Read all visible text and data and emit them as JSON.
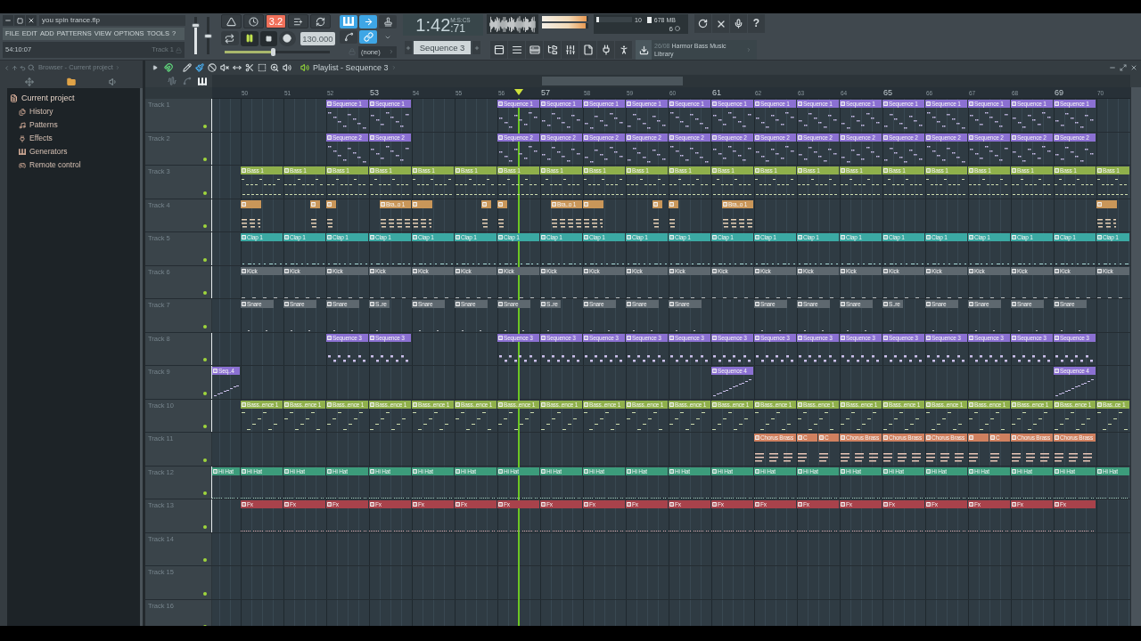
{
  "window": {
    "title": "you spin trance.flp"
  },
  "menu": [
    "FILE",
    "EDIT",
    "ADD",
    "PATTERNS",
    "VIEW",
    "OPTIONS",
    "TOOLS",
    "?"
  ],
  "hint_bar": {
    "position": "54:10:07",
    "target": "Track 1"
  },
  "mixer_sliders": [
    {
      "kind": "volume",
      "level": 0.8
    },
    {
      "kind": "pitch",
      "level": 0.5
    }
  ],
  "transport": {
    "buttons": [
      {
        "kind": "metronome",
        "on": false
      },
      {
        "kind": "wait",
        "on": false
      },
      {
        "kind": "countdown",
        "label": "3.2",
        "on": true
      },
      {
        "kind": "overdub",
        "on": false
      },
      {
        "kind": "loop",
        "on": false
      }
    ],
    "playing": true,
    "recording": false,
    "tempo": "130.000",
    "position": {
      "level": 0.46
    }
  },
  "snap_tools": {
    "buttons": [
      {
        "kind": "keyboard",
        "on": true
      },
      {
        "kind": "step",
        "on": true
      },
      {
        "kind": "stamp",
        "on": false
      },
      {
        "kind": "curve",
        "on": false
      },
      {
        "kind": "link",
        "on": true
      }
    ],
    "snap": "(none)"
  },
  "clock": {
    "time": "1:42",
    "fraction": ":71",
    "unit": "M:S:CS"
  },
  "pattern_selector": {
    "value": "Sequence 3"
  },
  "meters": {
    "output": [
      {
        "level": 0.97
      },
      {
        "level": 0.95
      }
    ],
    "cpu": {
      "value": "10",
      "level": 0.08
    },
    "memory": {
      "value": "678 MB"
    },
    "polyphony": "6"
  },
  "help_button": {
    "label": "?"
  },
  "news": {
    "date": "26/08",
    "title": "Harmor Bass Music Library"
  },
  "browser": {
    "title": "Browser - Current project",
    "tabs": [
      {
        "kind": "move",
        "selected": false
      },
      {
        "kind": "folder",
        "selected": true
      },
      {
        "kind": "speaker",
        "selected": false
      }
    ],
    "tree": [
      {
        "label": "Current project",
        "children": [
          {
            "label": "History"
          },
          {
            "label": "Patterns"
          },
          {
            "label": "Effects"
          },
          {
            "label": "Generators"
          },
          {
            "label": "Remote control"
          }
        ]
      }
    ]
  },
  "playlist": {
    "title": "Playlist - Sequence 3",
    "magnet": {
      "on": true
    },
    "tools": [
      {
        "kind": "pencil",
        "selected": false
      },
      {
        "kind": "brush",
        "selected": true
      },
      {
        "kind": "delete",
        "selected": false
      },
      {
        "kind": "mute",
        "selected": false
      },
      {
        "kind": "slip",
        "selected": false
      },
      {
        "kind": "slice",
        "selected": false
      },
      {
        "kind": "select",
        "selected": false
      },
      {
        "kind": "zoom",
        "selected": false
      },
      {
        "kind": "playback",
        "selected": false
      }
    ],
    "clip_filters": [
      {
        "kind": "audio",
        "selected": false
      },
      {
        "kind": "automation",
        "selected": false
      },
      {
        "kind": "pattern",
        "selected": true
      }
    ],
    "ruler": [
      {
        "label": "50",
        "major": false
      },
      {
        "label": "51",
        "major": false
      },
      {
        "label": "52",
        "major": false
      },
      {
        "label": "53",
        "major": true
      },
      {
        "label": "54",
        "major": false
      },
      {
        "label": "55",
        "major": false
      },
      {
        "label": "56",
        "major": false
      },
      {
        "label": "57",
        "major": true
      },
      {
        "label": "58",
        "major": false
      },
      {
        "label": "59",
        "major": false
      },
      {
        "label": "60",
        "major": false
      },
      {
        "label": "61",
        "major": true
      },
      {
        "label": "62",
        "major": false
      },
      {
        "label": "63",
        "major": false
      },
      {
        "label": "64",
        "major": false
      },
      {
        "label": "65",
        "major": true
      },
      {
        "label": "66",
        "major": false
      },
      {
        "label": "67",
        "major": false
      },
      {
        "label": "68",
        "major": false
      },
      {
        "label": "69",
        "major": true
      },
      {
        "label": "70",
        "major": false
      }
    ],
    "playhead": {
      "level": 0.334
    },
    "tracks": [
      {
        "name": "Track 1",
        "active": true,
        "enabled": true,
        "color": "#8b70d2",
        "bars": [
          {
            "kind": "empty"
          },
          {
            "kind": "empty"
          },
          {
            "label": "Sequence 1",
            "kind": "whole"
          },
          {
            "label": "Sequence 1",
            "kind": "whole"
          },
          {
            "kind": "empty"
          },
          {
            "kind": "empty"
          },
          {
            "label": "Sequence 1",
            "kind": "whole"
          },
          {
            "label": "Sequence 1",
            "kind": "whole"
          },
          {
            "label": "Sequence 1",
            "kind": "whole"
          },
          {
            "label": "Sequence 1",
            "kind": "whole"
          },
          {
            "label": "Sequence 1",
            "kind": "whole"
          },
          {
            "label": "Sequence 1",
            "kind": "whole"
          },
          {
            "label": "Sequence 1",
            "kind": "whole"
          },
          {
            "label": "Sequence 1",
            "kind": "whole"
          },
          {
            "label": "Sequence 1",
            "kind": "whole"
          },
          {
            "label": "Sequence 1",
            "kind": "whole"
          },
          {
            "label": "Sequence 1",
            "kind": "whole"
          },
          {
            "label": "Sequence 1",
            "kind": "whole"
          },
          {
            "label": "Sequence 1",
            "kind": "whole"
          },
          {
            "label": "Sequence 1",
            "kind": "whole"
          }
        ]
      },
      {
        "name": "Track 2",
        "active": true,
        "enabled": true,
        "color": "#8b70d2",
        "bars": [
          {
            "kind": "empty"
          },
          {
            "kind": "empty"
          },
          {
            "label": "Sequence 2",
            "kind": "whole"
          },
          {
            "label": "Sequence 2",
            "kind": "whole"
          },
          {
            "kind": "empty"
          },
          {
            "kind": "empty"
          },
          {
            "label": "Sequence 2",
            "kind": "whole"
          },
          {
            "label": "Sequence 2",
            "kind": "whole"
          },
          {
            "label": "Sequence 2",
            "kind": "whole"
          },
          {
            "label": "Sequence 2",
            "kind": "whole"
          },
          {
            "label": "Sequence 2",
            "kind": "whole"
          },
          {
            "label": "Sequence 2",
            "kind": "whole"
          },
          {
            "label": "Sequence 2",
            "kind": "whole"
          },
          {
            "label": "Sequence 2",
            "kind": "whole"
          },
          {
            "label": "Sequence 2",
            "kind": "whole"
          },
          {
            "label": "Sequence 2",
            "kind": "whole"
          },
          {
            "label": "Sequence 2",
            "kind": "whole"
          },
          {
            "label": "Sequence 2",
            "kind": "whole"
          },
          {
            "label": "Sequence 2",
            "kind": "whole"
          },
          {
            "label": "Sequence 2",
            "kind": "whole"
          }
        ]
      },
      {
        "name": "Track 3",
        "active": true,
        "enabled": true,
        "color": "#8fb04b",
        "bars": [
          {
            "label": "Bass 1",
            "kind": "whole"
          },
          {
            "label": "Bass 1",
            "kind": "whole"
          },
          {
            "label": "Bass 1",
            "kind": "whole"
          },
          {
            "label": "Bass 1",
            "kind": "whole"
          },
          {
            "label": "Bass 1",
            "kind": "whole"
          },
          {
            "label": "Bass 1",
            "kind": "whole"
          },
          {
            "label": "Bass 1",
            "kind": "whole"
          },
          {
            "label": "Bass 1",
            "kind": "whole"
          },
          {
            "label": "Bass 1",
            "kind": "whole"
          },
          {
            "label": "Bass 1",
            "kind": "whole"
          },
          {
            "label": "Bass 1",
            "kind": "whole"
          },
          {
            "label": "Bass 1",
            "kind": "whole"
          },
          {
            "label": "Bass 1",
            "kind": "whole"
          },
          {
            "label": "Bass 1",
            "kind": "whole"
          },
          {
            "label": "Bass 1",
            "kind": "whole"
          },
          {
            "label": "Bass 1",
            "kind": "whole"
          },
          {
            "label": "Bass 1",
            "kind": "whole"
          },
          {
            "label": "Bass 1",
            "kind": "whole"
          },
          {
            "label": "Bass 1",
            "kind": "whole"
          },
          {
            "label": "Bass 1",
            "kind": "whole"
          },
          {
            "label": "Bass 1",
            "kind": "whole"
          }
        ]
      },
      {
        "name": "Track 4",
        "active": true,
        "enabled": true,
        "color": "#c99659",
        "bars": [
          {
            "kind": "half"
          },
          {
            "kind": "pickup"
          },
          {
            "kind": "quarter"
          },
          {
            "label": "Bra..o 1",
            "kind": "late"
          },
          {
            "kind": "half"
          },
          {
            "kind": "pickup"
          },
          {
            "kind": "quarter"
          },
          {
            "label": "Bra..o 1",
            "kind": "late"
          },
          {
            "kind": "half"
          },
          {
            "kind": "pickup"
          },
          {
            "kind": "quarter"
          },
          {
            "label": "Bra..o 1",
            "kind": "late"
          },
          {
            "kind": "empty"
          },
          {
            "kind": "empty"
          },
          {
            "kind": "empty"
          },
          {
            "kind": "empty"
          },
          {
            "kind": "empty"
          },
          {
            "kind": "empty"
          },
          {
            "kind": "empty"
          },
          {
            "kind": "empty"
          },
          {
            "kind": "half"
          }
        ]
      },
      {
        "name": "Track 5",
        "active": true,
        "enabled": true,
        "color": "#3ba9a3",
        "bars": [
          {
            "label": "Clap 1",
            "kind": "whole"
          },
          {
            "label": "Clap 1",
            "kind": "whole"
          },
          {
            "label": "Clap 1",
            "kind": "whole"
          },
          {
            "label": "Clap 1",
            "kind": "whole"
          },
          {
            "label": "Clap 1",
            "kind": "whole"
          },
          {
            "label": "Clap 1",
            "kind": "whole"
          },
          {
            "label": "Clap 1",
            "kind": "whole"
          },
          {
            "label": "Clap 1",
            "kind": "whole"
          },
          {
            "label": "Clap 1",
            "kind": "whole"
          },
          {
            "label": "Clap 1",
            "kind": "whole"
          },
          {
            "label": "Clap 1",
            "kind": "whole"
          },
          {
            "label": "Clap 1",
            "kind": "whole"
          },
          {
            "label": "Clap 1",
            "kind": "whole"
          },
          {
            "label": "Clap 1",
            "kind": "whole"
          },
          {
            "label": "Clap 1",
            "kind": "whole"
          },
          {
            "label": "Clap 1",
            "kind": "whole"
          },
          {
            "label": "Clap 1",
            "kind": "whole"
          },
          {
            "label": "Clap 1",
            "kind": "whole"
          },
          {
            "label": "Clap 1",
            "kind": "whole"
          },
          {
            "label": "Clap 1",
            "kind": "whole"
          },
          {
            "label": "Clap 1",
            "kind": "whole"
          }
        ]
      },
      {
        "name": "Track 6",
        "active": true,
        "enabled": true,
        "color": "#5e686f",
        "bars": [
          {
            "label": "Kick",
            "kind": "whole"
          },
          {
            "label": "Kick",
            "kind": "whole"
          },
          {
            "label": "Kick",
            "kind": "whole"
          },
          {
            "label": "Kick",
            "kind": "whole"
          },
          {
            "label": "Kick",
            "kind": "whole"
          },
          {
            "label": "Kick",
            "kind": "whole"
          },
          {
            "label": "Kick",
            "kind": "whole"
          },
          {
            "label": "Kick",
            "kind": "whole"
          },
          {
            "label": "Kick",
            "kind": "whole"
          },
          {
            "label": "Kick",
            "kind": "whole"
          },
          {
            "label": "Kick",
            "kind": "whole"
          },
          {
            "label": "Kick",
            "kind": "whole"
          },
          {
            "label": "Kick",
            "kind": "whole"
          },
          {
            "label": "Kick",
            "kind": "whole"
          },
          {
            "label": "Kick",
            "kind": "whole"
          },
          {
            "label": "Kick",
            "kind": "whole"
          },
          {
            "label": "Kick",
            "kind": "whole"
          },
          {
            "label": "Kick",
            "kind": "whole"
          },
          {
            "label": "Kick",
            "kind": "whole"
          },
          {
            "label": "Kick",
            "kind": "whole"
          },
          {
            "label": "Kick",
            "kind": "whole"
          }
        ]
      },
      {
        "name": "Track 7",
        "active": false,
        "enabled": true,
        "color": "#5e686f",
        "bars": [
          {
            "label": "Snare",
            "kind": "short"
          },
          {
            "label": "Snare",
            "kind": "short"
          },
          {
            "label": "Snare",
            "kind": "short"
          },
          {
            "label": "S..re",
            "kind": "half"
          },
          {
            "label": "Snare",
            "kind": "short"
          },
          {
            "label": "Snare",
            "kind": "short"
          },
          {
            "label": "Snare",
            "kind": "short"
          },
          {
            "label": "S..re",
            "kind": "half"
          },
          {
            "label": "Snare",
            "kind": "short"
          },
          {
            "label": "Snare",
            "kind": "short"
          },
          {
            "label": "Snare",
            "kind": "short"
          },
          {
            "kind": "empty"
          },
          {
            "label": "Snare",
            "kind": "short"
          },
          {
            "label": "Snare",
            "kind": "short"
          },
          {
            "label": "Snare",
            "kind": "short"
          },
          {
            "label": "S..re",
            "kind": "half"
          },
          {
            "label": "Snare",
            "kind": "short"
          },
          {
            "label": "Snare",
            "kind": "short"
          },
          {
            "label": "Snare",
            "kind": "short"
          },
          {
            "label": "Snare",
            "kind": "short"
          }
        ]
      },
      {
        "name": "Track 8",
        "active": true,
        "enabled": true,
        "color": "#8b70d2",
        "bars": [
          {
            "kind": "empty"
          },
          {
            "kind": "empty"
          },
          {
            "label": "Sequence 3",
            "kind": "whole"
          },
          {
            "label": "Sequence 3",
            "kind": "whole"
          },
          {
            "kind": "empty"
          },
          {
            "kind": "empty"
          },
          {
            "label": "Sequence 3",
            "kind": "whole"
          },
          {
            "label": "Sequence 3",
            "kind": "whole"
          },
          {
            "label": "Sequence 3",
            "kind": "whole"
          },
          {
            "label": "Sequence 3",
            "kind": "whole"
          },
          {
            "label": "Sequence 3",
            "kind": "whole"
          },
          {
            "label": "Sequence 3",
            "kind": "whole"
          },
          {
            "label": "Sequence 3",
            "kind": "whole"
          },
          {
            "label": "Sequence 3",
            "kind": "whole"
          },
          {
            "label": "Sequence 3",
            "kind": "whole"
          },
          {
            "label": "Sequence 3",
            "kind": "whole"
          },
          {
            "label": "Sequence 3",
            "kind": "whole"
          },
          {
            "label": "Sequence 3",
            "kind": "whole"
          },
          {
            "label": "Sequence 3",
            "kind": "whole"
          },
          {
            "label": "Sequence 3",
            "kind": "whole"
          }
        ]
      },
      {
        "name": "Track 9",
        "active": true,
        "enabled": true,
        "color": "#8b70d2",
        "lead_in": {
          "label": "Seq..4"
        },
        "bars": [
          {
            "kind": "empty"
          },
          {
            "kind": "empty"
          },
          {
            "kind": "empty"
          },
          {
            "kind": "empty"
          },
          {
            "kind": "empty"
          },
          {
            "kind": "empty"
          },
          {
            "kind": "empty"
          },
          {
            "kind": "empty"
          },
          {
            "kind": "empty"
          },
          {
            "kind": "empty"
          },
          {
            "kind": "empty"
          },
          {
            "label": "Sequence 4",
            "kind": "whole"
          },
          {
            "kind": "empty"
          },
          {
            "kind": "empty"
          },
          {
            "kind": "empty"
          },
          {
            "kind": "empty"
          },
          {
            "kind": "empty"
          },
          {
            "kind": "empty"
          },
          {
            "kind": "empty"
          },
          {
            "label": "Sequence 4",
            "kind": "whole"
          }
        ]
      },
      {
        "name": "Track 10",
        "active": true,
        "enabled": true,
        "color": "#8fb04b",
        "bars": [
          {
            "label": "Bass..ence 1",
            "kind": "whole"
          },
          {
            "label": "Bass..ence 1",
            "kind": "whole"
          },
          {
            "label": "Bass..ence 1",
            "kind": "whole"
          },
          {
            "label": "Bass..ence 1",
            "kind": "whole"
          },
          {
            "label": "Bass..ence 1",
            "kind": "whole"
          },
          {
            "label": "Bass..ence 1",
            "kind": "whole"
          },
          {
            "label": "Bass..ence 1",
            "kind": "whole"
          },
          {
            "label": "Bass..ence 1",
            "kind": "whole"
          },
          {
            "label": "Bass..ence 1",
            "kind": "whole"
          },
          {
            "label": "Bass..ence 1",
            "kind": "whole"
          },
          {
            "label": "Bass..ence 1",
            "kind": "whole"
          },
          {
            "label": "Bass..ence 1",
            "kind": "whole"
          },
          {
            "label": "Bass..ence 1",
            "kind": "whole"
          },
          {
            "label": "Bass..ence 1",
            "kind": "whole"
          },
          {
            "label": "Bass..ence 1",
            "kind": "whole"
          },
          {
            "label": "Bass..ence 1",
            "kind": "whole"
          },
          {
            "label": "Bass..ence 1",
            "kind": "whole"
          },
          {
            "label": "Bass..ence 1",
            "kind": "whole"
          },
          {
            "label": "Bass..ence 1",
            "kind": "whole"
          },
          {
            "label": "Bass..ence 1",
            "kind": "whole"
          },
          {
            "label": "Bas..ce 1",
            "kind": "whole"
          }
        ]
      },
      {
        "name": "Track 11",
        "active": false,
        "enabled": true,
        "color": "#d0805f",
        "bars": [
          {
            "kind": "empty"
          },
          {
            "kind": "empty"
          },
          {
            "kind": "empty"
          },
          {
            "kind": "empty"
          },
          {
            "kind": "empty"
          },
          {
            "kind": "empty"
          },
          {
            "kind": "empty"
          },
          {
            "kind": "empty"
          },
          {
            "kind": "empty"
          },
          {
            "kind": "empty"
          },
          {
            "kind": "empty"
          },
          {
            "kind": "empty"
          },
          {
            "label": "Chorus Brass",
            "kind": "whole"
          },
          {
            "kind": "split",
            "clips": [
              {
                "label": "C",
                "kind": "half"
              },
              {
                "label": "C",
                "kind": "second-half"
              }
            ]
          },
          {
            "label": "Chorus Brass",
            "kind": "whole"
          },
          {
            "label": "Chorus Brass",
            "kind": "whole"
          },
          {
            "label": "Chorus Brass",
            "kind": "whole"
          },
          {
            "kind": "split",
            "clips": [
              {
                "kind": "half"
              },
              {
                "label": "C",
                "kind": "second-half"
              }
            ]
          },
          {
            "label": "Chorus Brass",
            "kind": "whole"
          },
          {
            "label": "Chorus Brass",
            "kind": "whole"
          }
        ]
      },
      {
        "name": "Track 12",
        "active": true,
        "enabled": true,
        "color": "#3c9c7b",
        "lead_in": {
          "label": "Hi Hat"
        },
        "bars": [
          {
            "label": "Hi Hat",
            "kind": "whole"
          },
          {
            "label": "Hi Hat",
            "kind": "whole"
          },
          {
            "label": "Hi Hat",
            "kind": "whole"
          },
          {
            "label": "Hi Hat",
            "kind": "whole"
          },
          {
            "label": "Hi Hat",
            "kind": "whole"
          },
          {
            "label": "Hi Hat",
            "kind": "whole"
          },
          {
            "label": "Hi Hat",
            "kind": "whole"
          },
          {
            "label": "Hi Hat",
            "kind": "whole"
          },
          {
            "label": "Hi Hat",
            "kind": "whole"
          },
          {
            "label": "Hi Hat",
            "kind": "whole"
          },
          {
            "label": "Hi Hat",
            "kind": "whole"
          },
          {
            "label": "Hi Hat",
            "kind": "whole"
          },
          {
            "label": "Hi Hat",
            "kind": "whole"
          },
          {
            "label": "Hi Hat",
            "kind": "whole"
          },
          {
            "label": "Hi Hat",
            "kind": "whole"
          },
          {
            "label": "Hi Hat",
            "kind": "whole"
          },
          {
            "label": "Hi Hat",
            "kind": "whole"
          },
          {
            "label": "Hi Hat",
            "kind": "whole"
          },
          {
            "label": "Hi Hat",
            "kind": "whole"
          },
          {
            "label": "Hi Hat",
            "kind": "whole"
          },
          {
            "label": "Hi Hat",
            "kind": "whole"
          }
        ]
      },
      {
        "name": "Track 13",
        "active": true,
        "enabled": true,
        "color": "#a8424b",
        "bars": [
          {
            "label": "Fx",
            "kind": "whole"
          },
          {
            "label": "Fx",
            "kind": "whole"
          },
          {
            "label": "Fx",
            "kind": "whole"
          },
          {
            "label": "Fx",
            "kind": "whole"
          },
          {
            "label": "Fx",
            "kind": "whole"
          },
          {
            "label": "Fx",
            "kind": "whole"
          },
          {
            "label": "Fx",
            "kind": "whole"
          },
          {
            "label": "Fx",
            "kind": "whole"
          },
          {
            "label": "Fx",
            "kind": "whole"
          },
          {
            "label": "Fx",
            "kind": "whole"
          },
          {
            "label": "Fx",
            "kind": "whole"
          },
          {
            "label": "Fx",
            "kind": "whole"
          },
          {
            "label": "Fx",
            "kind": "whole"
          },
          {
            "label": "Fx",
            "kind": "whole"
          },
          {
            "label": "Fx",
            "kind": "whole"
          },
          {
            "label": "Fx",
            "kind": "whole"
          },
          {
            "label": "Fx",
            "kind": "whole"
          },
          {
            "label": "Fx",
            "kind": "whole"
          },
          {
            "label": "Fx",
            "kind": "whole"
          },
          {
            "label": "Fx",
            "kind": "whole"
          }
        ]
      },
      {
        "name": "Track 14",
        "active": false,
        "enabled": true
      },
      {
        "name": "Track 15",
        "active": false,
        "enabled": true
      },
      {
        "name": "Track 16",
        "active": false,
        "enabled": true
      }
    ]
  }
}
